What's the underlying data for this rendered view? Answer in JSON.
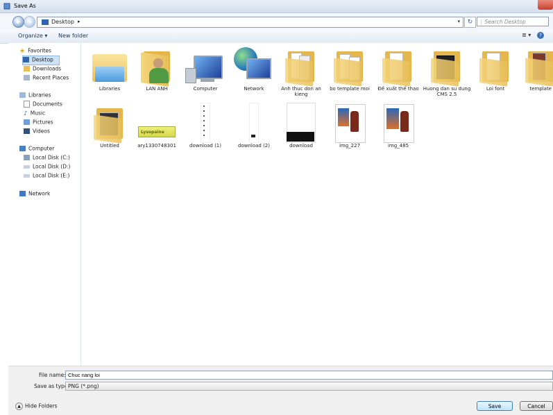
{
  "window": {
    "title": "Save As"
  },
  "address": {
    "location": "Desktop",
    "search_placeholder": "Search Desktop"
  },
  "toolbar": {
    "organize": "Organize ▾",
    "new_folder": "New folder",
    "views": "≣ ▾",
    "help": "?"
  },
  "nav": {
    "favorites": "Favorites",
    "desktop": "Desktop",
    "downloads": "Downloads",
    "recent": "Recent Places",
    "libraries": "Libraries",
    "documents": "Documents",
    "music": "Music",
    "pictures": "Pictures",
    "videos": "Videos",
    "computer": "Computer",
    "disk_c": "Local Disk (C:)",
    "disk_d": "Local Disk (D:)",
    "disk_e": "Local Disk (E:)",
    "network": "Network"
  },
  "files": [
    {
      "name": "Libraries",
      "icon": "libraries-icon"
    },
    {
      "name": "LAN ANH",
      "icon": "user-folder-icon"
    },
    {
      "name": "Computer",
      "icon": "computer-icon"
    },
    {
      "name": "Network",
      "icon": "network-icon"
    },
    {
      "name": "Anh thuc don an kieng",
      "icon": "folder-icon"
    },
    {
      "name": "bo template moi",
      "icon": "folder-icon"
    },
    {
      "name": "Đề xuất thể thao",
      "icon": "folder-icon"
    },
    {
      "name": "Huong dan su dung CMS 2.5",
      "icon": "folder-icon"
    },
    {
      "name": "Loi font",
      "icon": "folder-icon"
    },
    {
      "name": "template",
      "icon": "folder-icon"
    },
    {
      "name": "Untitled",
      "icon": "folder-icon"
    },
    {
      "name": "ary1330748301",
      "icon": "image-thumbnail-icon",
      "thumb_text": "Lysopaine"
    },
    {
      "name": "download (1)",
      "icon": "image-thumbnail-icon"
    },
    {
      "name": "download (2)",
      "icon": "image-thumbnail-icon"
    },
    {
      "name": "download",
      "icon": "image-thumbnail-icon"
    },
    {
      "name": "img_227",
      "icon": "image-thumbnail-icon"
    },
    {
      "name": "img_485",
      "icon": "image-thumbnail-icon"
    }
  ],
  "form": {
    "file_name_label": "File name:",
    "file_name_value": "Chuc nang loi",
    "save_type_label": "Save as type:",
    "save_type_value": "PNG (*.png)",
    "hide_folders": "Hide Folders",
    "save": "Save",
    "cancel": "Cancel"
  },
  "colors": {
    "accent": "#3c7fb1",
    "folder": "#e8bf58",
    "selection": "#cde2f8"
  }
}
